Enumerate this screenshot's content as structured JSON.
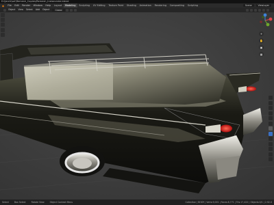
{
  "window": {
    "title": "D:\\Jarch\\sol\\Remesh_Copies\\Remesh_Instanciate.blend"
  },
  "menu": {
    "items": [
      "File",
      "Edit",
      "Render",
      "Window",
      "Help"
    ],
    "workspaces": [
      "Layout",
      "Modeling",
      "Sculpting",
      "UV Editing",
      "Texture Paint",
      "Shading",
      "Animation",
      "Rendering",
      "Compositing",
      "Scripting"
    ],
    "active_workspace": "Modeling",
    "scene_label": "Scene",
    "view_layer_label": "ViewLayer"
  },
  "header": {
    "mode": "Object",
    "view": "View",
    "select": "Select",
    "add": "Add",
    "object": "Object",
    "transform": "Global"
  },
  "status": {
    "select": "Select",
    "box_select": "Box Select",
    "rotate_view": "Rotate View",
    "context_menu": "Object Context Menu",
    "stats": "Collection | BODY | Verts:9,001 | Faces:8,771 | Tris:17,422 | Objects:0/1 | 2.92.0"
  },
  "colors": {
    "accent": "#e87d0d",
    "viewport_bg": "#3d3d3d",
    "car_body": "#1a1a14",
    "chrome": "#c8c6bf",
    "tail_light": "#e32318",
    "whitewall": "#e6e6e6",
    "axis_x": "#e0454b",
    "axis_y": "#6fa72c",
    "axis_z": "#3f83d6"
  },
  "icons": [
    "blender-logo",
    "hand-pan-icon",
    "camera-view-icon",
    "perspective-grid-icon",
    "zoom-icon",
    "move-tool-icon",
    "rotate-tool-icon",
    "scale-tool-icon",
    "navigation-gizmo-icon"
  ]
}
